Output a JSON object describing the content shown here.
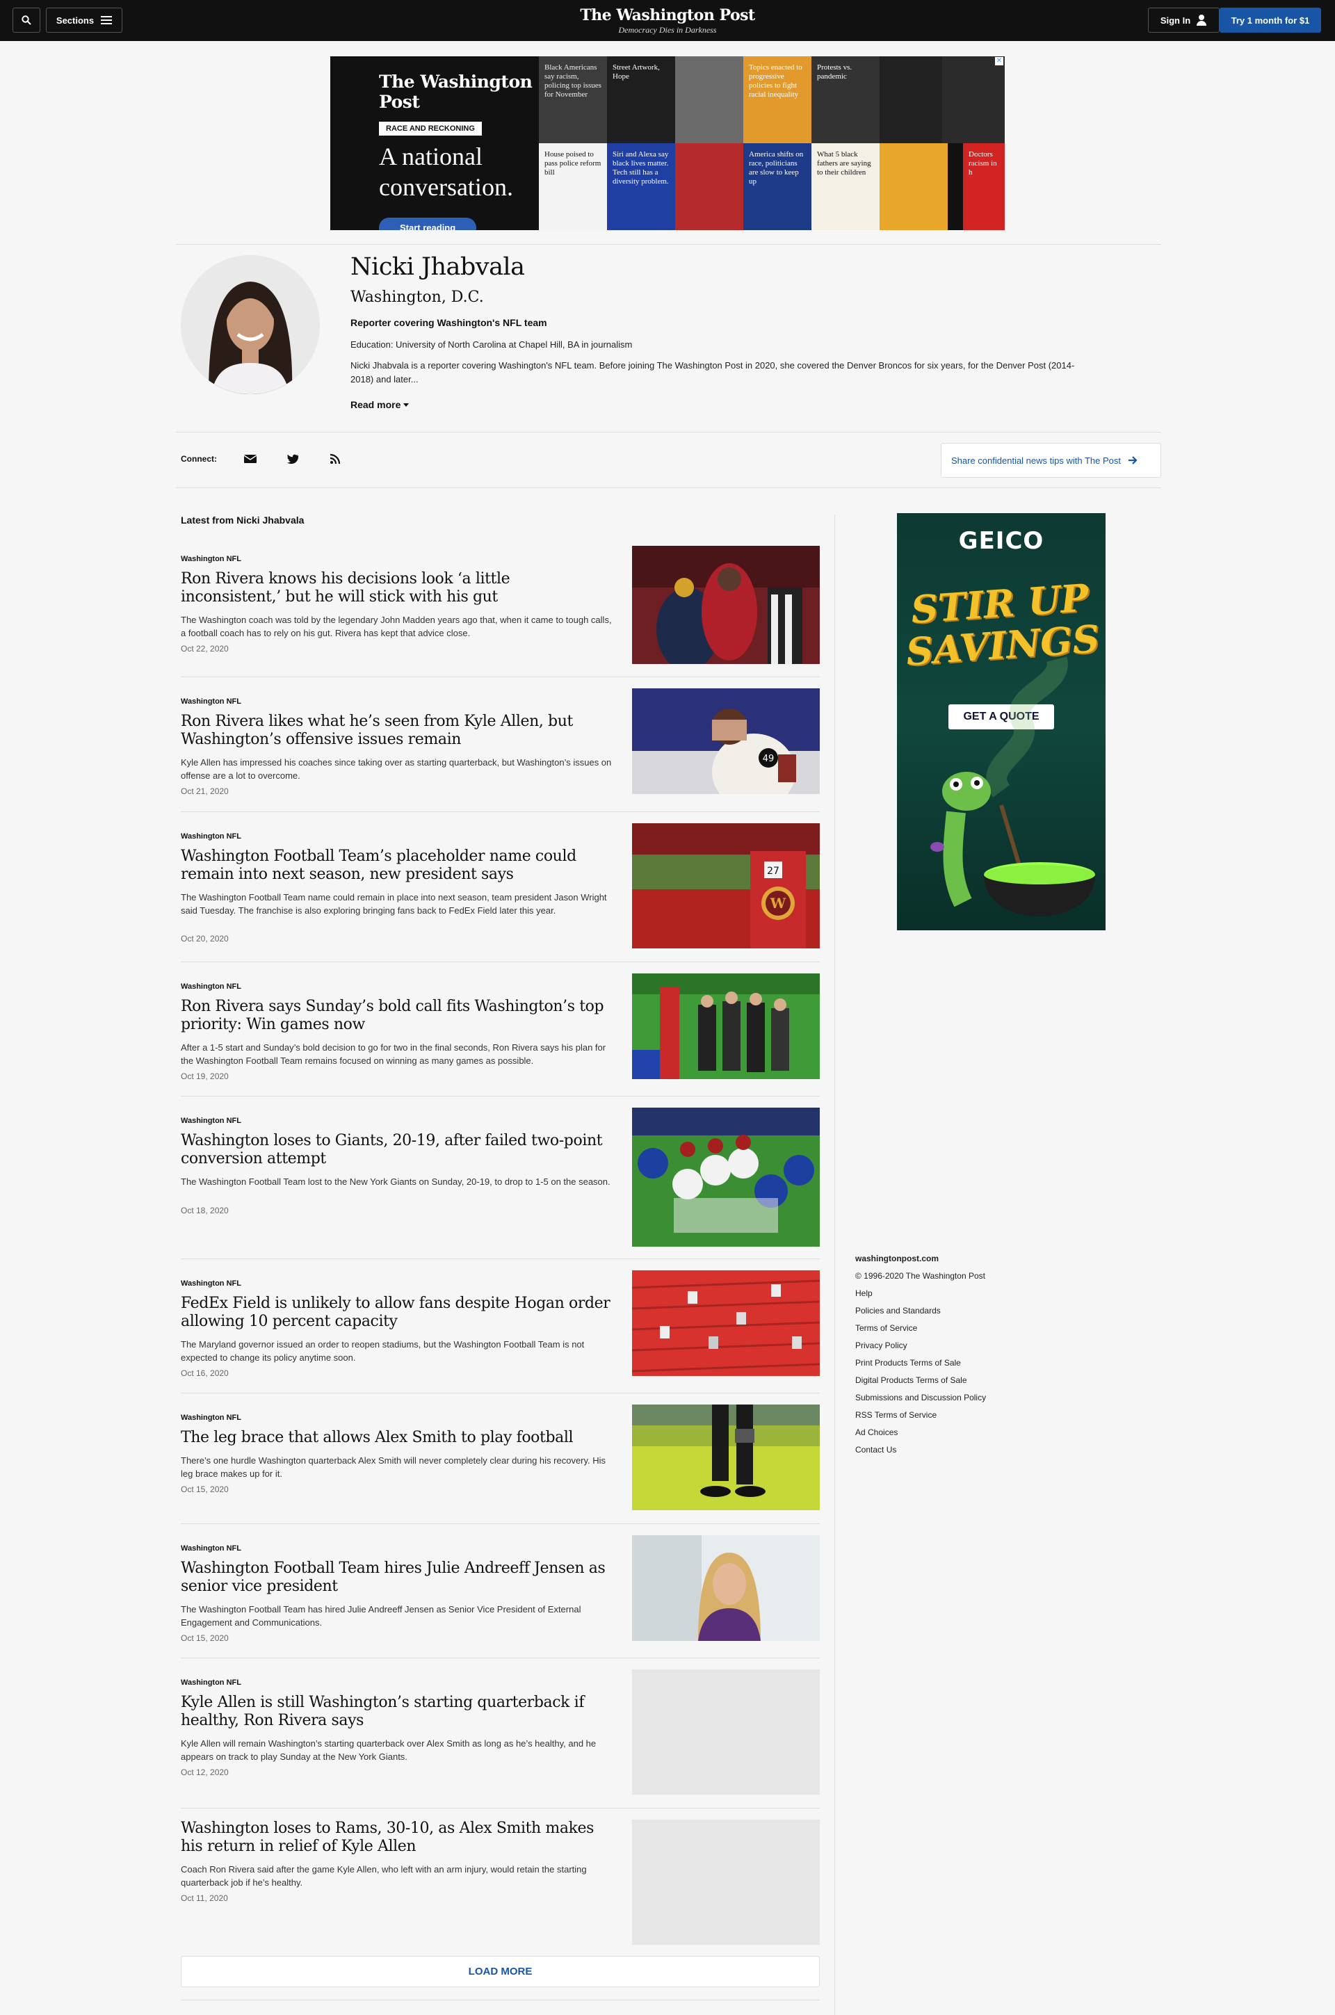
{
  "nav": {
    "sections_label": "Sections",
    "brand_name": "The Washington Post",
    "brand_tagline": "Democracy Dies in Darkness",
    "signin_label": "Sign In",
    "subscribe_label": "Try 1 month for $1"
  },
  "top_ad": {
    "logo": "The Washington Post",
    "badge": "RACE AND RECKONING",
    "headline_line1": "A national",
    "headline_line2": "conversation.",
    "button": "Start reading",
    "tiles": [
      "Black Americans say racism, policing top issues for November",
      "Street Artwork, Hope",
      "Topics enacted to progressive policies to fight racial inequality",
      "Protests vs. pandemic",
      "House poised to pass police reform bill",
      "Siri and Alexa say black lives matter. Tech still has a diversity problem.",
      "America shifts on race, politicians are slow to keep up",
      "What 5 black fathers are saying to their children",
      "Doctors racism in h"
    ]
  },
  "author": {
    "name": "Nicki Jhabvala",
    "location": "Washington, D.C.",
    "title": "Reporter covering Washington's NFL team",
    "education": "Education: University of North Carolina at Chapel Hill, BA in journalism",
    "bio": "Nicki Jhabvala is a reporter covering Washington's NFL team. Before joining The Washington Post in 2020, she covered the Denver Broncos for six years, for the Denver Post (2014-2018) and later...",
    "read_more": "Read more"
  },
  "connect": {
    "label": "Connect:",
    "tips": "Share confidential news tips with The Post"
  },
  "latest_title": "Latest from Nicki Jhabvala",
  "articles": [
    {
      "kicker": "Washington NFL",
      "headline": "Ron Rivera knows his decisions look ‘a little inconsistent,’ but he will stick with his gut",
      "blurb": "The Washington coach was told by the legendary John Madden years ago that, when it came to tough calls, a football coach has to rely on his gut. Rivera has kept that advice close.",
      "date": "Oct 22, 2020"
    },
    {
      "kicker": "Washington NFL",
      "headline": "Ron Rivera likes what he’s seen from Kyle Allen, but Washington’s offensive issues remain",
      "blurb": "Kyle Allen has impressed his coaches since taking over as starting quarterback, but Washington’s issues on offense are a lot to overcome.",
      "date": "Oct 21, 2020"
    },
    {
      "kicker": "Washington NFL",
      "headline": "Washington Football Team’s placeholder name could remain into next season, new president says",
      "blurb": "The Washington Football Team name could remain in place into next season, team president Jason Wright said Tuesday. The franchise is also exploring bringing fans back to FedEx Field later this year.",
      "date": "Oct 20, 2020"
    },
    {
      "kicker": "Washington NFL",
      "headline": "Ron Rivera says Sunday’s bold call fits Washington’s top priority: Win games now",
      "blurb": "After a 1-5 start and Sunday’s bold decision to go for two in the final seconds, Ron Rivera says his plan for the Washington Football Team remains focused on winning as many games as possible.",
      "date": "Oct 19, 2020"
    },
    {
      "kicker": "Washington NFL",
      "headline": "Washington loses to Giants, 20-19, after failed two-point conversion attempt",
      "blurb": "The Washington Football Team lost to the New York Giants on Sunday, 20-19, to drop to 1-5 on the season.",
      "date": "Oct 18, 2020"
    },
    {
      "kicker": "Washington NFL",
      "headline": "FedEx Field is unlikely to allow fans despite Hogan order allowing 10 percent capacity",
      "blurb": "The Maryland governor issued an order to reopen stadiums, but the Washington Football Team is not expected to change its policy anytime soon.",
      "date": "Oct 16, 2020"
    },
    {
      "kicker": "Washington NFL",
      "headline": "The leg brace that allows Alex Smith to play football",
      "blurb": "There’s one hurdle Washington quarterback Alex Smith will never completely clear during his recovery. His leg brace makes up for it.",
      "date": "Oct 15, 2020"
    },
    {
      "kicker": "Washington NFL",
      "headline": "Washington Football Team hires Julie Andreeff Jensen as senior vice president",
      "blurb": "The Washington Football Team has hired Julie Andreeff Jensen as Senior Vice President of External Engagement and Communications.",
      "date": "Oct 15, 2020"
    },
    {
      "kicker": "Washington NFL",
      "headline": "Kyle Allen is still Washington’s starting quarterback if healthy, Ron Rivera says",
      "blurb": "Kyle Allen will remain Washington’s starting quarterback over Alex Smith as long as he’s healthy, and he appears on track to play Sunday at the New York Giants.",
      "date": "Oct 12, 2020"
    },
    {
      "kicker": "",
      "headline": "Washington loses to Rams, 30-10, as Alex Smith makes his return in relief of Kyle Allen",
      "blurb": "Coach Ron Rivera said after the game Kyle Allen, who left with an arm injury, would retain the starting quarterback job if he’s healthy.",
      "date": "Oct 11, 2020"
    }
  ],
  "load_more": "LOAD MORE",
  "side_ad": {
    "brand": "GEICO",
    "line1": "STIR UP",
    "line2": "SAVINGS",
    "button": "GET A QUOTE"
  },
  "footer": {
    "site": "washingtonpost.com",
    "copyright": "© 1996-2020 The Washington Post",
    "links": [
      "Help",
      "Policies and Standards",
      "Terms of Service",
      "Privacy Policy",
      "Print Products Terms of Sale",
      "Digital Products Terms of Sale",
      "Submissions and Discussion Policy",
      "RSS Terms of Service",
      "Ad Choices",
      "Contact Us"
    ]
  }
}
